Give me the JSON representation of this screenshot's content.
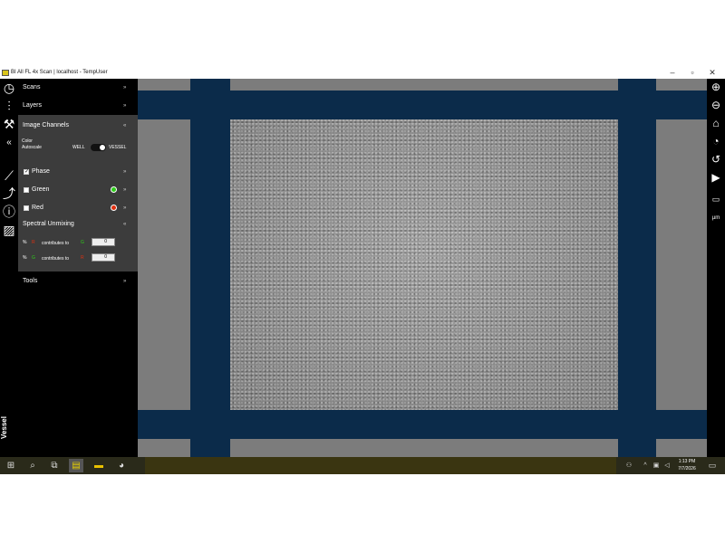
{
  "window": {
    "title": "BI All FL 4x Scan | localhost - TempUser",
    "minimize": "–",
    "maximize": "▫",
    "close": "✕"
  },
  "panel": {
    "scans_label": "Scans",
    "layers_label": "Layers",
    "image_channels_label": "Image Channels",
    "color_autoscale_label": "Color\nAutoscale",
    "toggle_left": "WELL",
    "toggle_right": "VESSEL",
    "collapse_glyph": "«",
    "chevron_glyph": "»",
    "channels": [
      {
        "name": "Phase",
        "checked": true
      },
      {
        "name": "Green",
        "checked": false,
        "color": "#2ecc1a"
      },
      {
        "name": "Red",
        "checked": false,
        "color": "#e03010"
      }
    ],
    "spectral_label": "Spectral Unmixing",
    "unmixing": [
      {
        "pct": "%",
        "src": "R",
        "src_color": "#e03010",
        "mid": "contributes to",
        "dst": "G",
        "dst_color": "#2ecc1a",
        "value": "0"
      },
      {
        "pct": "%",
        "src": "G",
        "src_color": "#2ecc1a",
        "mid": "contributes to",
        "dst": "R",
        "dst_color": "#e03010",
        "value": "0"
      }
    ],
    "tools_label": "Tools"
  },
  "sidebar_label": "Vessel",
  "right_toolbar": {
    "icons": [
      "zoom-in-icon",
      "zoom-out-icon",
      "home-icon",
      "history-icon",
      "restore-icon",
      "play-icon",
      "ruler-icon",
      "micron-icon"
    ],
    "micron_label": "µm"
  },
  "taskbar": {
    "time": "1:13 PM",
    "date": "7/7/2026"
  },
  "colors": {
    "vessel_bg": "#0b2b4a",
    "panel_bg": "#3c3c3c",
    "well_gray": "#7c7c7c"
  }
}
